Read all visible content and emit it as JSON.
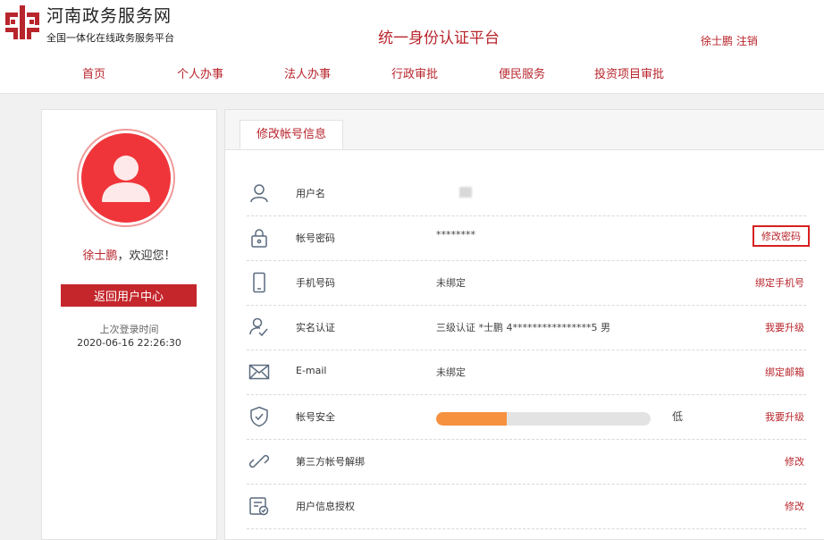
{
  "header": {
    "site_title": "河南政务服务网",
    "site_subtitle": "全国一体化在线政务服务平台",
    "platform_title": "统一身份认证平台",
    "user_name": "徐士鹏",
    "logout": "注销",
    "brand_color": "#b8252c"
  },
  "nav": {
    "items": [
      {
        "label": "首页"
      },
      {
        "label": "个人办事"
      },
      {
        "label": "法人办事"
      },
      {
        "label": "行政审批"
      },
      {
        "label": "便民服务"
      },
      {
        "label": "投资项目审批"
      }
    ]
  },
  "sidebar": {
    "name": "徐士鹏",
    "welcome_suffix": "，欢迎您！",
    "back_button": "返回用户中心",
    "last_login_label": "上次登录时间",
    "last_login_time": "2020-06-16 22:26:30",
    "avatar_icon": "user-avatar-icon"
  },
  "tab": {
    "label": "修改帐号信息"
  },
  "rows": [
    {
      "icon": "user-icon",
      "label": "用户名",
      "value": "",
      "action": ""
    },
    {
      "icon": "lock-icon",
      "label": "帐号密码",
      "value": "********",
      "action": "修改密码"
    },
    {
      "icon": "phone-icon",
      "label": "手机号码",
      "value": "未绑定",
      "action": "绑定手机号"
    },
    {
      "icon": "verified-user-icon",
      "label": "实名认证",
      "value": "三级认证 *士鹏 4****************5 男",
      "action": "我要升级"
    },
    {
      "icon": "mail-icon",
      "label": "E-mail",
      "value": "未绑定",
      "action": "绑定邮箱"
    },
    {
      "icon": "shield-icon",
      "label": "帐号安全",
      "value": "",
      "action": "我要升级"
    },
    {
      "icon": "link-icon",
      "label": "第三方帐号解绑",
      "value": "",
      "action": "修改"
    },
    {
      "icon": "authorize-icon",
      "label": "用户信息授权",
      "value": "",
      "action": "修改"
    }
  ],
  "security": {
    "level_label": "低",
    "progress_fraction": 0.33,
    "fill_color": "#f6913f"
  }
}
